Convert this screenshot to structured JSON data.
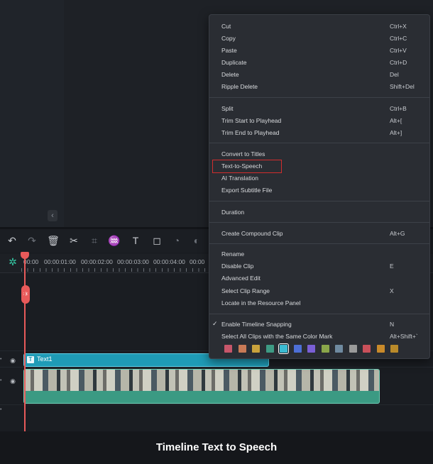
{
  "caption": "Timeline Text to Speech",
  "toolbar": {
    "icons": [
      "undo-icon",
      "redo-icon",
      "delete-icon",
      "cut-icon",
      "crop-icon",
      "audio-icon",
      "text-icon",
      "shape-icon",
      "speed-icon",
      "color-icon"
    ]
  },
  "ruler": {
    "times": [
      "00:00",
      "00:00:01:00",
      "00:00:02:00",
      "00:00:03:00",
      "00:00:04:00",
      "00:00"
    ]
  },
  "timeline": {
    "title_clip_label": "Text1"
  },
  "context_menu": {
    "groups": [
      [
        {
          "label": "Cut",
          "shortcut": "Ctrl+X"
        },
        {
          "label": "Copy",
          "shortcut": "Ctrl+C"
        },
        {
          "label": "Paste",
          "shortcut": "Ctrl+V"
        },
        {
          "label": "Duplicate",
          "shortcut": "Ctrl+D"
        },
        {
          "label": "Delete",
          "shortcut": "Del"
        },
        {
          "label": "Ripple Delete",
          "shortcut": "Shift+Del"
        }
      ],
      [
        {
          "label": "Split",
          "shortcut": "Ctrl+B"
        },
        {
          "label": "Trim Start to Playhead",
          "shortcut": "Alt+["
        },
        {
          "label": "Trim End to Playhead",
          "shortcut": "Alt+]"
        }
      ],
      [
        {
          "label": "Convert to Titles",
          "shortcut": ""
        },
        {
          "label": "Text-to-Speech",
          "shortcut": "",
          "highlighted": true
        },
        {
          "label": "AI Translation",
          "shortcut": ""
        },
        {
          "label": "Export Subtitle File",
          "shortcut": ""
        }
      ],
      [
        {
          "label": "Duration",
          "shortcut": ""
        }
      ],
      [
        {
          "label": "Create Compound Clip",
          "shortcut": "Alt+G"
        }
      ],
      [
        {
          "label": "Rename",
          "shortcut": ""
        },
        {
          "label": "Disable Clip",
          "shortcut": "E"
        },
        {
          "label": "Advanced Edit",
          "shortcut": ""
        },
        {
          "label": "Select Clip Range",
          "shortcut": "X"
        },
        {
          "label": "Locate in the Resource Panel",
          "shortcut": ""
        }
      ],
      [
        {
          "label": "Enable Timeline Snapping",
          "shortcut": "N",
          "checked": true
        },
        {
          "label": "Select All Clips with the Same Color Mark",
          "shortcut": "Alt+Shift+`"
        }
      ]
    ],
    "color_marks": [
      "#c7566a",
      "#c97a56",
      "#c9a23c",
      "#3e9b84",
      "#3bbbd2",
      "#4d6fd6",
      "#7a5fd6",
      "#8aa64a",
      "#6f8aa0",
      "#9a9a9a",
      "#c9505a",
      "#c98a2a",
      "#b98a2a"
    ],
    "selected_color_index": 4
  },
  "colors": {
    "accent_teal": "#3e9b84",
    "title_clip": "#1f9bb6",
    "playhead": "#e85a5a",
    "highlight_border": "#d22d2d"
  }
}
